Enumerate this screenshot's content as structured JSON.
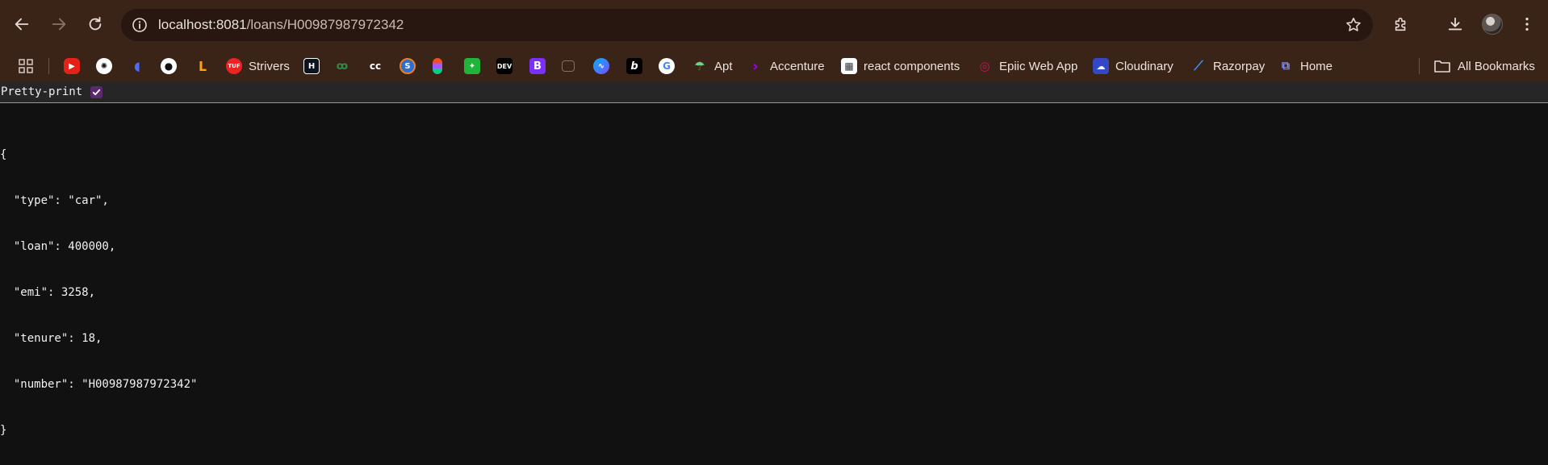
{
  "browser": {
    "url_host": "localhost:8081",
    "url_path": "/loans/H00987987972342",
    "colors": {
      "toolbar": "#3a2317",
      "omnibox": "#271710"
    }
  },
  "bookmarks": [
    {
      "label": "",
      "icon": "youtube-icon"
    },
    {
      "label": "",
      "icon": "chatgpt-icon"
    },
    {
      "label": "",
      "icon": "deepseek-icon"
    },
    {
      "label": "",
      "icon": "github-icon"
    },
    {
      "label": "",
      "icon": "leetcode-icon"
    },
    {
      "label": "Strivers",
      "icon": "tuf-icon",
      "badge": "TUF"
    },
    {
      "label": "",
      "icon": "hackerrank-icon",
      "badge": "H"
    },
    {
      "label": "",
      "icon": "geeksforgeeks-icon"
    },
    {
      "label": "",
      "icon": "codechef-icon",
      "badge": "cc"
    },
    {
      "label": "",
      "icon": "s-icon",
      "badge": "S"
    },
    {
      "label": "",
      "icon": "figma-icon"
    },
    {
      "label": "",
      "icon": "green-app-icon"
    },
    {
      "label": "",
      "icon": "dev-icon",
      "badge": "DEV"
    },
    {
      "label": "",
      "icon": "bootstrap-icon",
      "badge": "B"
    },
    {
      "label": "",
      "icon": "tab-icon"
    },
    {
      "label": "",
      "icon": "messenger-icon"
    },
    {
      "label": "",
      "icon": "b-icon",
      "badge": "b"
    },
    {
      "label": "",
      "icon": "google-icon",
      "badge": "G"
    },
    {
      "label": "Apt",
      "icon": "apt-icon"
    },
    {
      "label": "Accenture",
      "icon": "accenture-icon"
    },
    {
      "label": "react components",
      "icon": "react-components-icon"
    },
    {
      "label": "Epiic Web App",
      "icon": "epiic-icon"
    },
    {
      "label": "Cloudinary",
      "icon": "cloudinary-icon"
    },
    {
      "label": "Razorpay",
      "icon": "razorpay-icon"
    },
    {
      "label": "Home",
      "icon": "home-icon"
    }
  ],
  "all_bookmarks_label": "All Bookmarks",
  "viewer": {
    "pretty_print_label": "Pretty-print",
    "pretty_print_checked": true,
    "json_lines": [
      "{",
      "  \"type\": \"car\",",
      "  \"loan\": 400000,",
      "  \"emi\": 3258,",
      "  \"tenure\": 18,",
      "  \"number\": \"H00987987972342\"",
      "}"
    ]
  }
}
